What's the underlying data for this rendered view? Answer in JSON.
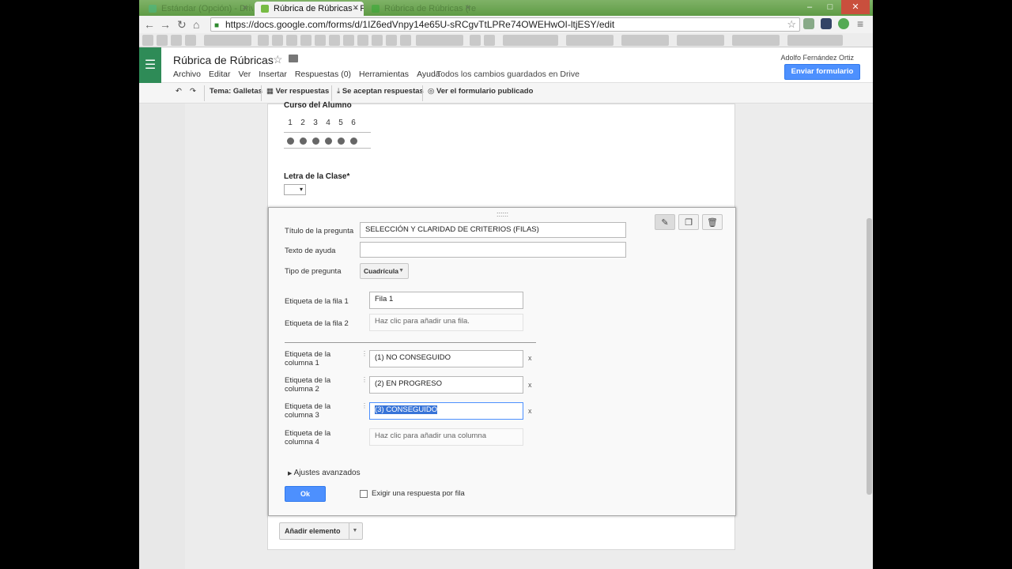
{
  "browser": {
    "tabs": [
      {
        "label": "Estándar (Opción) - Drive",
        "active": false
      },
      {
        "label": "Rúbrica de Rúbricas - F",
        "active": true
      },
      {
        "label": "Rúbrica de Rúbricas (resp)",
        "active": false
      }
    ],
    "url": "https://docs.google.com/forms/d/1IZ6edVnpy14e65U-sRCgvTtLPRe74OWEHwOI-ltjESY/edit",
    "window_controls": [
      "–",
      "□",
      "✕"
    ]
  },
  "app": {
    "title": "Rúbrica de Rúbricas",
    "menu": [
      "Archivo",
      "Editar",
      "Ver",
      "Insertar",
      "Respuestas (0)",
      "Herramientas",
      "Ayuda"
    ],
    "save_status": "Todos los cambios guardados en Drive",
    "user": "Adolfo Fernández Ortiz",
    "send_button": "Enviar formulario"
  },
  "form_toolbar": {
    "theme": "Tema: Galletas",
    "view_responses": "Ver respuestas",
    "accepting": "Se aceptan respuestas",
    "view_published": "Ver el formulario publicado"
  },
  "form": {
    "prev_question": {
      "label": "Curso del Alumno",
      "scale": [
        "1",
        "2",
        "3",
        "4",
        "5",
        "6"
      ]
    },
    "class_letter": {
      "label": "Letra de la Clase*",
      "select_value": "▾"
    },
    "editor": {
      "grip": "::::::",
      "title_label": "Título de la pregunta",
      "title_value": "SELECCIÓN Y CLARIDAD DE CRITERIOS (FILAS)",
      "help_label": "Texto de ayuda",
      "help_value": "",
      "type_label": "Tipo de pregunta",
      "type_value": "Cuadrícula",
      "rows": [
        {
          "label": "Etiqueta de la fila 1",
          "value": "Fila 1",
          "placeholder": false
        },
        {
          "label": "Etiqueta de la fila 2",
          "value": "Haz clic para añadir una fila.",
          "placeholder": true
        }
      ],
      "columns": [
        {
          "label": "Etiqueta de la columna 1",
          "value": "(1) NO CONSEGUIDO",
          "placeholder": false
        },
        {
          "label": "Etiqueta de la columna 2",
          "value": "(2) EN PROGRESO",
          "placeholder": false
        },
        {
          "label": "Etiqueta de la columna 3",
          "value": "(3) CONSEGUIDO",
          "placeholder": false,
          "selected": true
        },
        {
          "label": "Etiqueta de la columna 4",
          "value": "Haz clic para añadir una columna",
          "placeholder": true
        }
      ],
      "remove_glyph": "x",
      "advanced": "Ajustes avanzados",
      "ok": "Ok",
      "require_label": "Exigir una respuesta por fila"
    },
    "add_item": "Añadir elemento"
  },
  "colors": {
    "accent": "#4d90fe",
    "tabbar": "#6aa84f",
    "forms_green": "#2e8b57"
  }
}
